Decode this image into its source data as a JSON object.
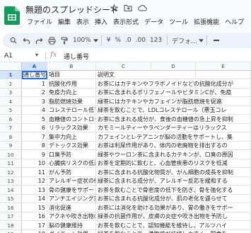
{
  "title": "無題のスプレッドシート",
  "menu": [
    "ファイル",
    "編集",
    "表示",
    "挿入",
    "表示形式",
    "データ",
    "ツール",
    "拡張機能",
    "ヘルプ"
  ],
  "toolbar": {
    "zoom": "100%",
    "currency": "¥",
    "percent": "%",
    "dec_decrease": ".0",
    "dec_increase": ".00",
    "number_format": "123",
    "font": "デフォ..."
  },
  "formula_bar": {
    "name_box": "A1",
    "fx": "fx",
    "value": "通し番号"
  },
  "columns": [
    "A",
    "B",
    "C",
    "D",
    "E"
  ],
  "selected_column": "A",
  "rows": [
    {
      "n": "1",
      "a": "通し番号",
      "b": "項目",
      "c": "説明文"
    },
    {
      "n": "2",
      "a": "1",
      "b": "抗酸化作用",
      "c": "お茶にはカテキンやフラボノイドなどの抗酸化成分が"
    },
    {
      "n": "3",
      "a": "2",
      "b": "免疫力向上",
      "c": "お茶に含まれるポリフェノールやビタミンCが、免疫"
    },
    {
      "n": "4",
      "a": "3",
      "b": "脂肪燃焼効果",
      "c": "緑茶にはカテキンやカフェインが脂肪燃焼を促進"
    },
    {
      "n": "5",
      "a": "4",
      "b": "コレステロール低下",
      "c": "緑茶を飲むことで、LDLコレステロール（悪玉コレ"
    },
    {
      "n": "6",
      "a": "5",
      "b": "血糖値のコントロール",
      "c": "お茶に含まれる成分が、食後の血糖値の急上昇を抑制"
    },
    {
      "n": "7",
      "a": "6",
      "b": "リラックス効果",
      "c": "カモミールティーやラベンダーティーはリラックス"
    },
    {
      "n": "8",
      "a": "7",
      "b": "集中力向上",
      "c": "カフェインとL-テアニンが脳の活動をサポートし、集"
    },
    {
      "n": "9",
      "a": "8",
      "b": "デトックス効果",
      "c": "お茶は利尿作用があり、体内の老廃物を排出するの"
    },
    {
      "n": "10",
      "a": "9",
      "b": "口臭予防",
      "c": "緑茶やウーロン茶に含まれるカテキンが、口臭の原因"
    },
    {
      "n": "11",
      "a": "10",
      "b": "心臓病リスクの低減",
      "c": "お茶を定期的に飲むと、心血管疾患のリスクを低減"
    },
    {
      "n": "12",
      "a": "11",
      "b": "がん予防",
      "c": "お茶に含まれる抗酸化物質が、がん細胞の成長を抑制"
    },
    {
      "n": "13",
      "a": "12",
      "b": "アレルギー症状の軽減",
      "c": "緑茶に含まれる成分が、アレルギー反応を緩和する"
    },
    {
      "n": "14",
      "a": "13",
      "b": "骨の健康をサポート",
      "c": "お茶を飲むことで骨密度の低下を防ぎ、骨を強化する"
    },
    {
      "n": "15",
      "a": "14",
      "b": "アンチエイジング効果",
      "c": "お茶に含まれる抗酸化成分が、肌の老化を遅らせて"
    },
    {
      "n": "16",
      "a": "15",
      "b": "消化促進",
      "c": "お茶には消化を助ける効果があり、胃の働きをサポー"
    },
    {
      "n": "17",
      "a": "16",
      "b": "アクネや吹き出物の予防",
      "c": "緑茶の抗菌作用が、皮膚の炎症や吹き出物を予防し"
    },
    {
      "n": "18",
      "a": "17",
      "b": "脳の健康維持",
      "c": "お茶を飲むことで、認知機能を維持し、アルツハイ"
    },
    {
      "n": "19",
      "a": "18",
      "b": "ダイエット効果",
      "c": "緑茶を飲むことで、満腹感が持続しやすく、間食を"
    }
  ],
  "colors": {
    "accent": "#1a73e8",
    "sheets_green": "#0f9d58",
    "header_bg": "#f8f9fa",
    "selected_header_bg": "#d3e3fd"
  }
}
